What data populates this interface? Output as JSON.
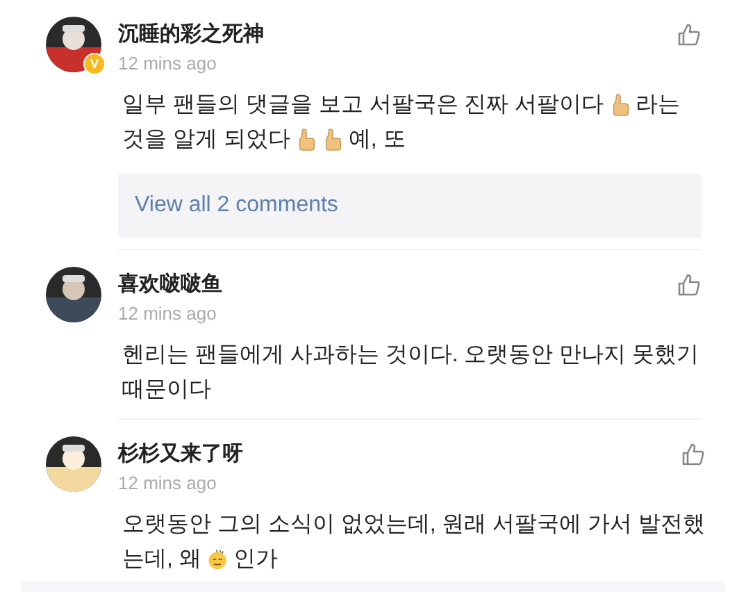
{
  "comments": [
    {
      "author": "沉睡的彩之死神",
      "verified": true,
      "badge": "V",
      "time": "12 mins ago",
      "lines": [
        [
          {
            "kind": "text",
            "text": "일부 팬들의 댓글을 보고 서팔국은 진짜 서팔이다"
          },
          {
            "kind": "thumbsup"
          },
          {
            "kind": "text",
            "text": "라는"
          }
        ],
        [
          {
            "kind": "text",
            "text": "것을 알게 되었다"
          },
          {
            "kind": "thumbsup"
          },
          {
            "kind": "thumbsup"
          },
          {
            "kind": "text",
            "text": "예, 또"
          }
        ]
      ],
      "replies": "View all 2 comments"
    },
    {
      "author": "喜欢啵啵鱼",
      "verified": false,
      "time": "12 mins ago",
      "lines": [
        [
          {
            "kind": "text",
            "text": "헨리는 팬들에게 사과하는 것이다. 오랫동안 만나지 못했기"
          }
        ],
        [
          {
            "kind": "text",
            "text": "때문이다"
          }
        ]
      ]
    },
    {
      "author": "杉杉又来了呀",
      "verified": false,
      "time": "12 mins ago",
      "lines": [
        [
          {
            "kind": "text",
            "text": "오랫동안 그의 소식이 없었는데, 원래 서팔국에 가서 발전했"
          }
        ],
        [
          {
            "kind": "text",
            "text": "는데, 왜"
          },
          {
            "kind": "sweat"
          },
          {
            "kind": "text",
            "text": "인가"
          }
        ]
      ]
    }
  ]
}
